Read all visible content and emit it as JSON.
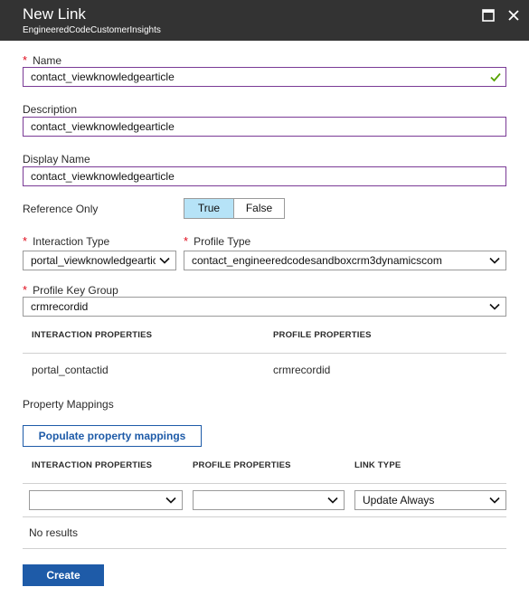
{
  "window": {
    "title": "New Link",
    "subtitle": "EngineeredCodeCustomerInsights",
    "maximize_icon": "maximize-icon",
    "close_icon": "close-icon"
  },
  "form": {
    "name": {
      "label": "Name",
      "required": true,
      "value": "contact_viewknowledgearticle",
      "valid": true
    },
    "description": {
      "label": "Description",
      "value": "contact_viewknowledgearticle"
    },
    "display_name": {
      "label": "Display Name",
      "value": "contact_viewknowledgearticle"
    },
    "reference_only": {
      "label": "Reference Only",
      "options": [
        "True",
        "False"
      ],
      "selected": "True"
    },
    "interaction_type": {
      "label": "Interaction Type",
      "required": true,
      "value": "portal_viewknowledgearticle"
    },
    "profile_type": {
      "label": "Profile Type",
      "required": true,
      "value": "contact_engineeredcodesandboxcrm3dynamicscom"
    },
    "profile_key_group": {
      "label": "Profile Key Group",
      "required": true,
      "value": "crmrecordid"
    }
  },
  "key_table": {
    "headers": [
      "INTERACTION PROPERTIES",
      "PROFILE PROPERTIES"
    ],
    "rows": [
      [
        "portal_contactid",
        "crmrecordid"
      ]
    ]
  },
  "property_mappings": {
    "label": "Property Mappings",
    "populate_button": "Populate property mappings",
    "headers": [
      "INTERACTION PROPERTIES",
      "PROFILE PROPERTIES",
      "LINK TYPE"
    ],
    "interaction_value": "",
    "profile_value": "",
    "link_type_value": "Update Always",
    "empty_text": "No results"
  },
  "actions": {
    "create": "Create"
  },
  "colors": {
    "titlebar": "#333333",
    "accent": "#1e5ba8",
    "toggle_selected": "#b6e3f7",
    "focus_border": "#7a3b96",
    "required": "#e00b1c",
    "valid": "#57a300"
  }
}
